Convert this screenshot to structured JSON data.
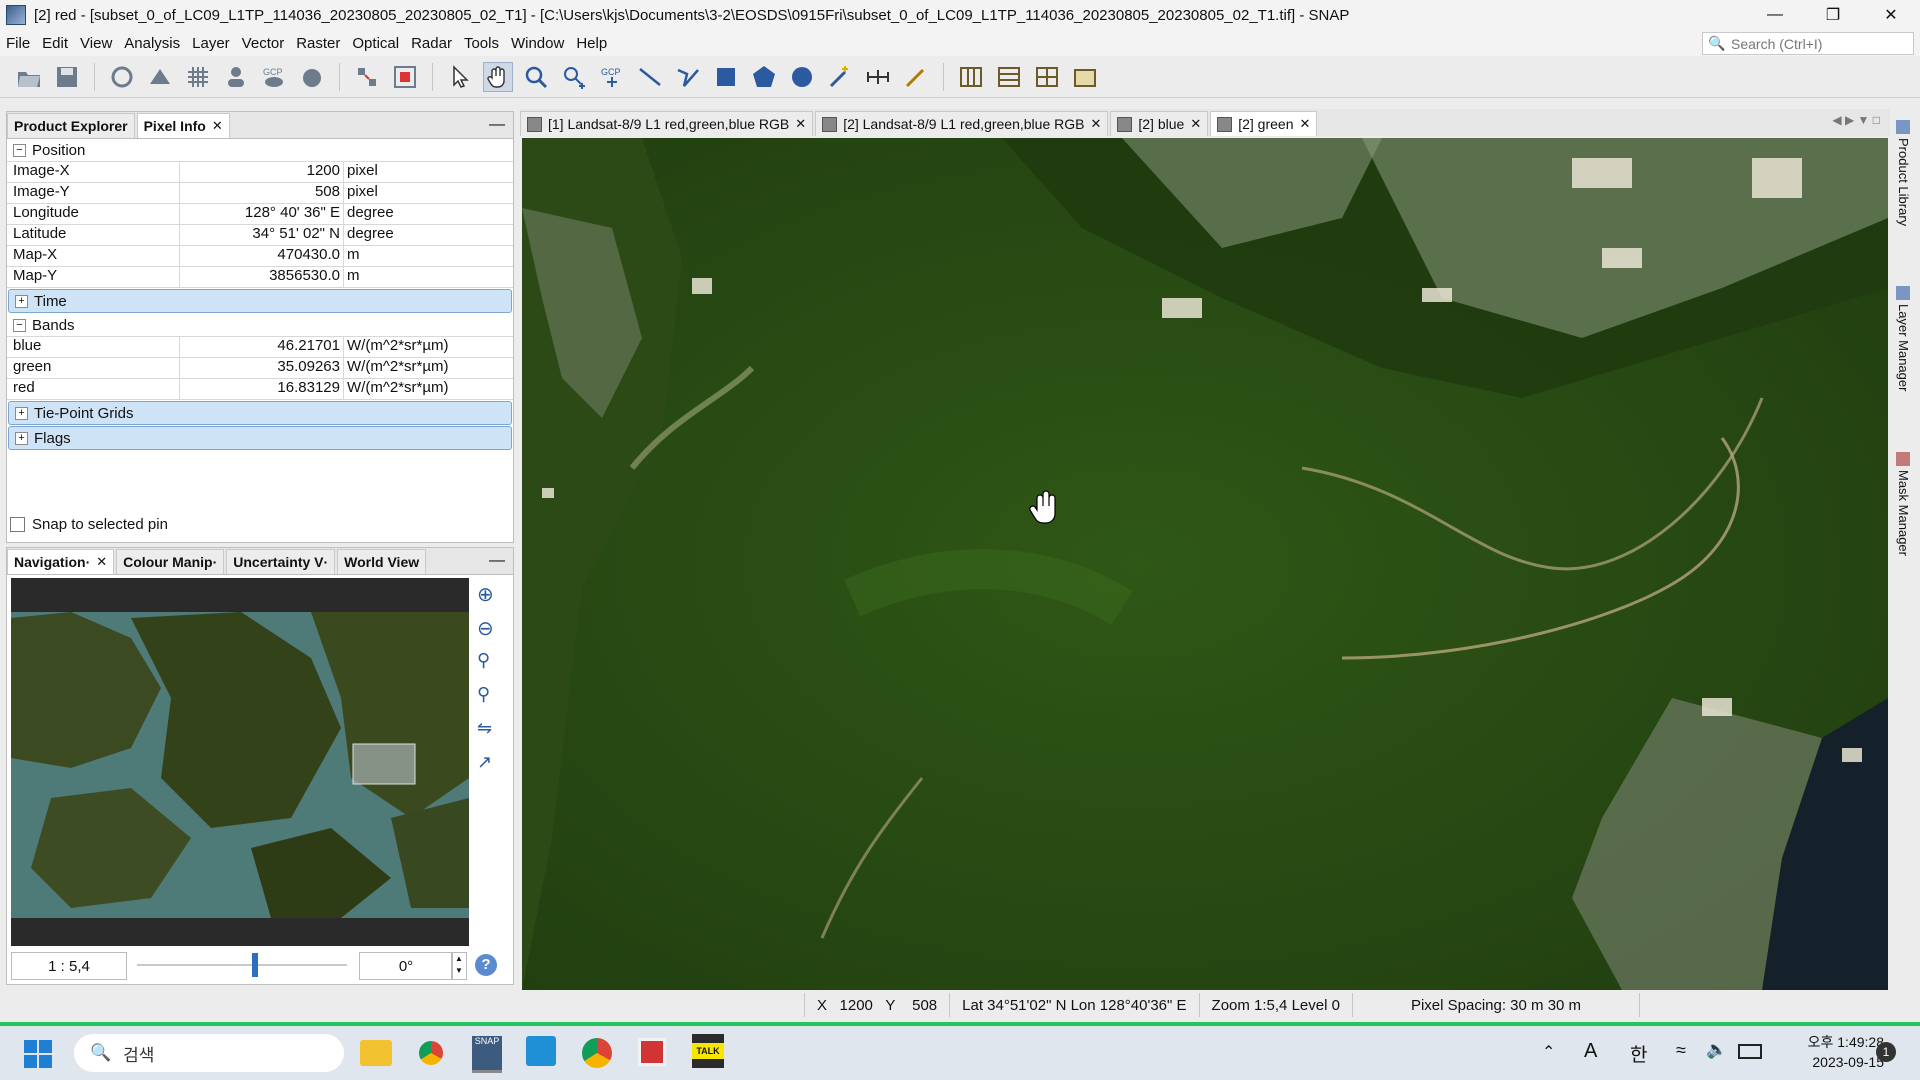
{
  "window": {
    "title": "[2] red - [subset_0_of_LC09_L1TP_114036_20230805_20230805_02_T1] - [C:\\Users\\kjs\\Documents\\3-2\\EOSDS\\0915Fri\\subset_0_of_LC09_L1TP_114036_20230805_20230805_02_T1.tif] - SNAP"
  },
  "menu": [
    "File",
    "Edit",
    "View",
    "Analysis",
    "Layer",
    "Vector",
    "Raster",
    "Optical",
    "Radar",
    "Tools",
    "Window",
    "Help"
  ],
  "search": {
    "placeholder": "Search (Ctrl+I)"
  },
  "left_tabs": {
    "product_explorer": "Product Explorer",
    "pixel_info": "Pixel Info"
  },
  "pixel_info": {
    "position_label": "Position",
    "position_rows": [
      {
        "name": "Image-X",
        "value": "1200",
        "unit": "pixel"
      },
      {
        "name": "Image-Y",
        "value": "508",
        "unit": "pixel"
      },
      {
        "name": "Longitude",
        "value": "128° 40' 36\" E",
        "unit": "degree"
      },
      {
        "name": "Latitude",
        "value": "34° 51' 02\" N",
        "unit": "degree"
      },
      {
        "name": "Map-X",
        "value": "470430.0",
        "unit": "m"
      },
      {
        "name": "Map-Y",
        "value": "3856530.0",
        "unit": "m"
      }
    ],
    "time_label": "Time",
    "bands_label": "Bands",
    "band_rows": [
      {
        "name": "blue",
        "value": "46.21701",
        "unit": "W/(m^2*sr*µm)"
      },
      {
        "name": "green",
        "value": "35.09263",
        "unit": "W/(m^2*sr*µm)"
      },
      {
        "name": "red",
        "value": "16.83129",
        "unit": "W/(m^2*sr*µm)"
      }
    ],
    "tiepoint_label": "Tie-Point Grids",
    "flags_label": "Flags",
    "snap_label": "Snap to selected pin"
  },
  "nav_tabs": [
    "Navigation·",
    "Colour Manip·",
    "Uncertainty V·",
    "World View"
  ],
  "navigation": {
    "scale": "1 : 5,4",
    "rotation": "0°",
    "slider_fraction": 0.56
  },
  "image_tabs": [
    {
      "label": "[1] Landsat-8/9 L1 red,green,blue RGB",
      "active": false
    },
    {
      "label": "[2] Landsat-8/9 L1 red,green,blue RGB",
      "active": false
    },
    {
      "label": "[2] blue",
      "active": false
    },
    {
      "label": "[2] green",
      "active": true
    }
  ],
  "right_sidebar": [
    "Product Library",
    "Layer Manager",
    "Mask Manager"
  ],
  "status": {
    "x_label": "X",
    "x": "1200",
    "y_label": "Y",
    "y": "508",
    "latlon": "Lat 34°51'02\" N  Lon 128°40'36\" E",
    "zoom": "Zoom 1:5,4  Level 0",
    "spacing": "Pixel Spacing: 30 m 30 m"
  },
  "taskbar": {
    "search_placeholder": "검색",
    "ime_a": "A",
    "ime_han": "한",
    "time": "오후 1:49:28",
    "date": "2023-09-15",
    "notif": "1"
  }
}
